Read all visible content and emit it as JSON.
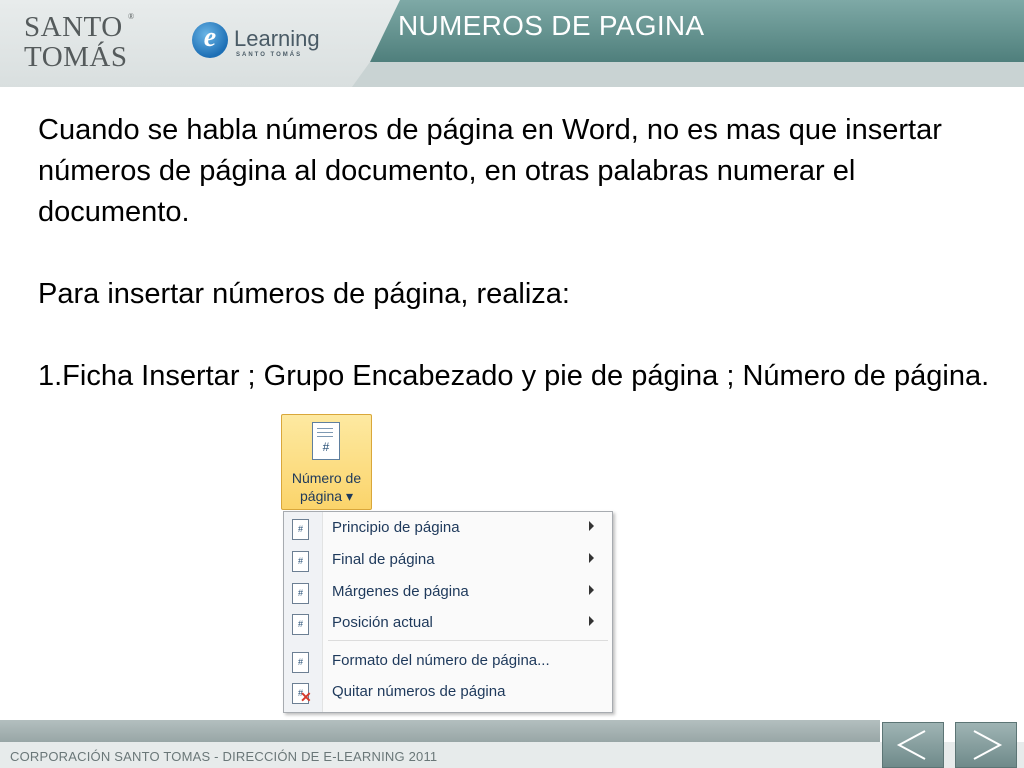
{
  "header": {
    "logo_line1": "SANTO",
    "logo_line2": "TOMÁS",
    "logo_reg": "®",
    "elearning_badge": "e",
    "elearning_word": "Learning",
    "elearning_sub": "SANTO TOMÁS",
    "slide_title": "NUMEROS DE PAGINA"
  },
  "content": {
    "paragraph1": "Cuando se habla números de página en Word, no es mas que insertar números de página al documento, en otras palabras numerar el documento.",
    "paragraph2": "Para insertar números de página, realiza:",
    "paragraph3": "1.Ficha Insertar ; Grupo Encabezado y pie de página ; Número de página."
  },
  "ribbon_button": {
    "icon_glyph": "#",
    "label_line1": "Número de",
    "label_line2": "página ▾"
  },
  "menu": {
    "items": [
      {
        "label": "Principio de página",
        "icon": "page-top-icon",
        "glyph": "#",
        "submenu": true
      },
      {
        "label": "Final de página",
        "icon": "page-bottom-icon",
        "glyph": "#",
        "submenu": true
      },
      {
        "label": "Márgenes de página",
        "icon": "page-margins-icon",
        "glyph": "#",
        "submenu": true
      },
      {
        "label": "Posición actual",
        "icon": "current-position-icon",
        "glyph": "#",
        "submenu": true
      },
      {
        "label": "Formato del número de página...",
        "icon": "format-page-number-icon",
        "glyph": "#",
        "submenu": false
      },
      {
        "label": "Quitar números de página",
        "icon": "remove-page-numbers-icon",
        "glyph": "#",
        "submenu": false
      }
    ],
    "remove_mark": "✕"
  },
  "footer": {
    "text": "CORPORACIÓN SANTO TOMAS - DIRECCIÓN DE E-LEARNING  2011"
  },
  "colors": {
    "title_banner": "#5f8f8c",
    "ribbon_highlight": "#fbd46b",
    "menu_text": "#1e395b"
  }
}
